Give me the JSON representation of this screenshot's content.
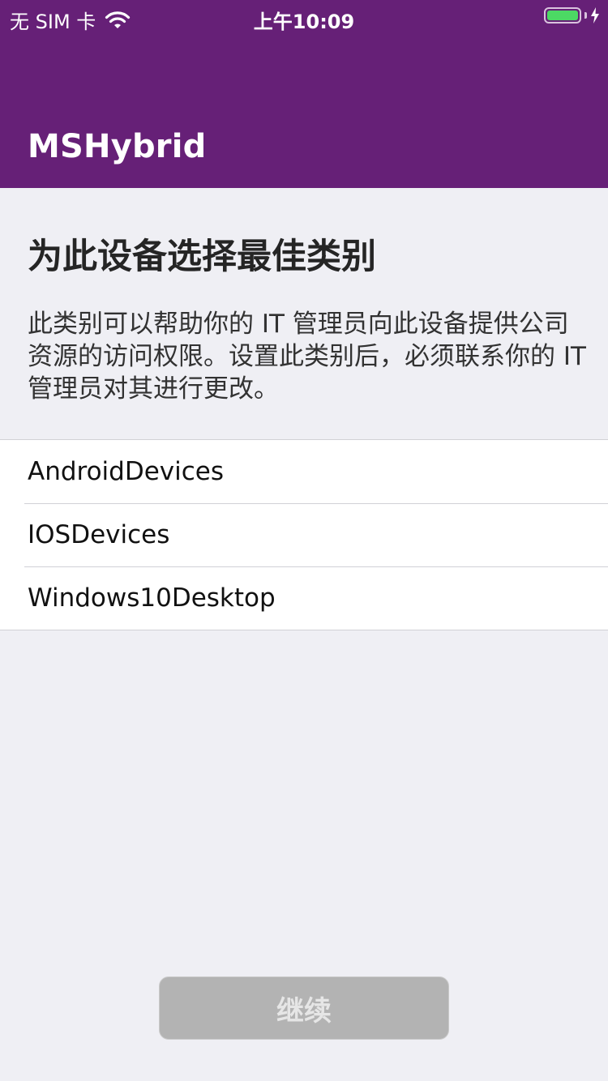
{
  "status_bar": {
    "carrier": "无 SIM 卡",
    "time": "上午10:09",
    "battery_level": 1.0,
    "battery_color": "#4cd964"
  },
  "header": {
    "title": "MSHybrid",
    "background_color": "#662077"
  },
  "main": {
    "title": "为此设备选择最佳类别",
    "description": "此类别可以帮助你的 IT 管理员向此设备提供公司资源的访问权限。设置此类别后，必须联系你的 IT 管理员对其进行更改。",
    "categories": [
      {
        "label": "AndroidDevices"
      },
      {
        "label": "IOSDevices"
      },
      {
        "label": "Windows10Desktop"
      }
    ]
  },
  "footer": {
    "continue_label": "继续",
    "continue_enabled": false
  }
}
